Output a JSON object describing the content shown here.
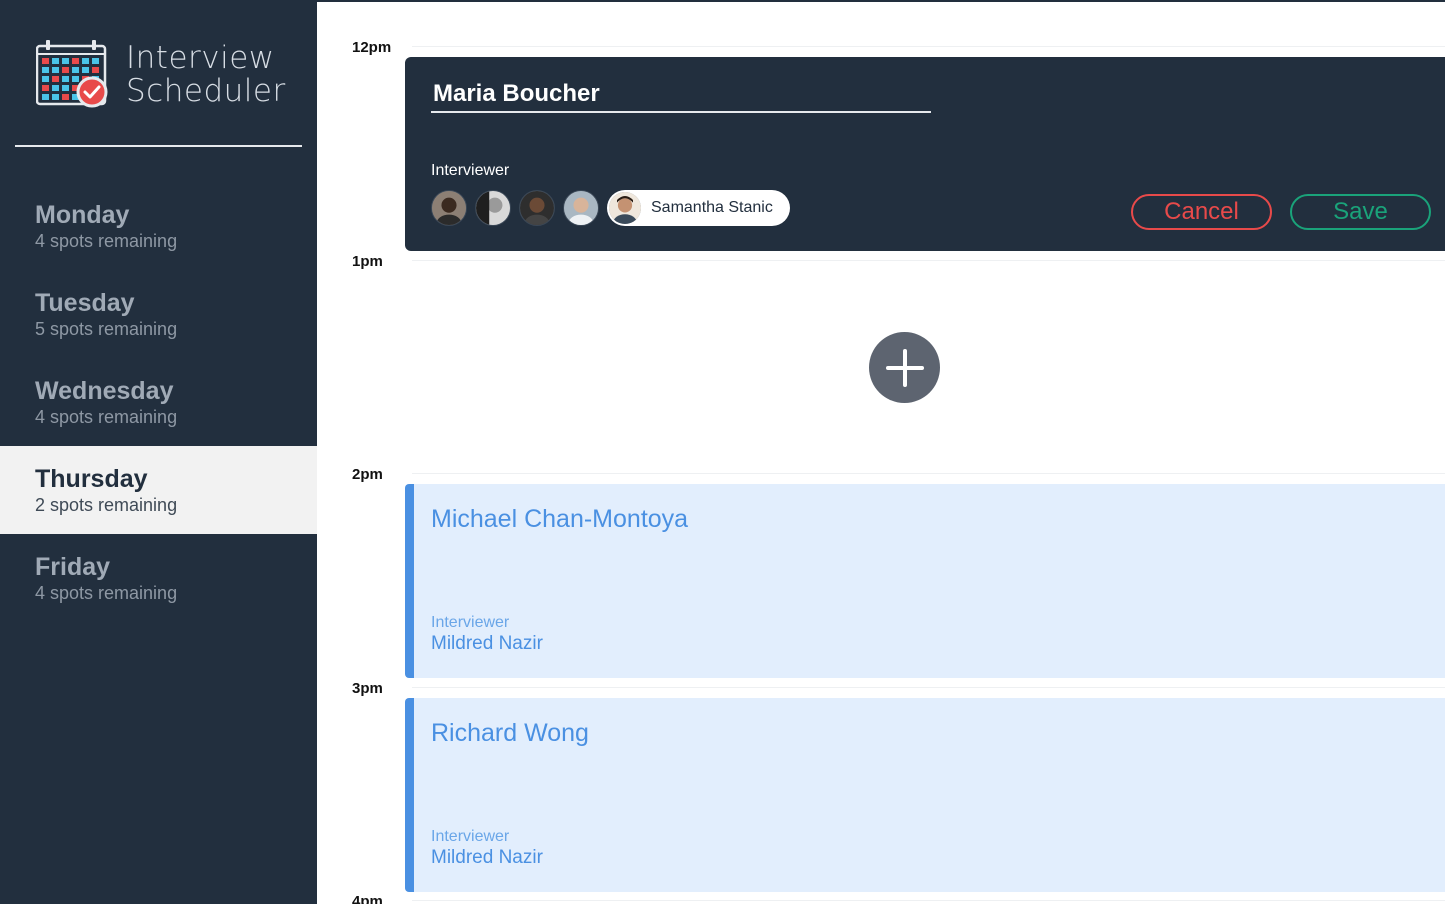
{
  "brand": {
    "title_line1": "Interview",
    "title_line2": "Scheduler",
    "logo_icon": "calendar-check-icon",
    "colors": {
      "sidebar": "#222f3e",
      "logo_cells": [
        "#e84a4a",
        "#4ac4e8"
      ]
    }
  },
  "days": [
    {
      "name": "Monday",
      "spots": "4 spots remaining",
      "selected": false
    },
    {
      "name": "Tuesday",
      "spots": "5 spots remaining",
      "selected": false
    },
    {
      "name": "Wednesday",
      "spots": "4 spots remaining",
      "selected": false
    },
    {
      "name": "Thursday",
      "spots": "2 spots remaining",
      "selected": true
    },
    {
      "name": "Friday",
      "spots": "4 spots remaining",
      "selected": false
    }
  ],
  "times": [
    "12pm",
    "1pm",
    "2pm",
    "3pm",
    "4pm"
  ],
  "form": {
    "student_name": "Maria Boucher",
    "interviewer_heading": "Interviewer",
    "interviewers": [
      {
        "avatar": "avatar-icon"
      },
      {
        "avatar": "avatar-icon"
      },
      {
        "avatar": "avatar-icon"
      },
      {
        "avatar": "avatar-icon"
      }
    ],
    "selected_interviewer": "Samantha Stanic",
    "cancel_label": "Cancel",
    "save_label": "Save",
    "colors": {
      "cancel": "#e84a4a",
      "save": "#1aa37a"
    }
  },
  "add_button": {
    "icon": "plus-icon"
  },
  "appointments": [
    {
      "student": "Michael Chan-Montoya",
      "interviewer_heading": "Interviewer",
      "interviewer": "Mildred Nazir"
    },
    {
      "student": "Richard Wong",
      "interviewer_heading": "Interviewer",
      "interviewer": "Mildred Nazir"
    }
  ],
  "accent_color": "#4a90e2"
}
